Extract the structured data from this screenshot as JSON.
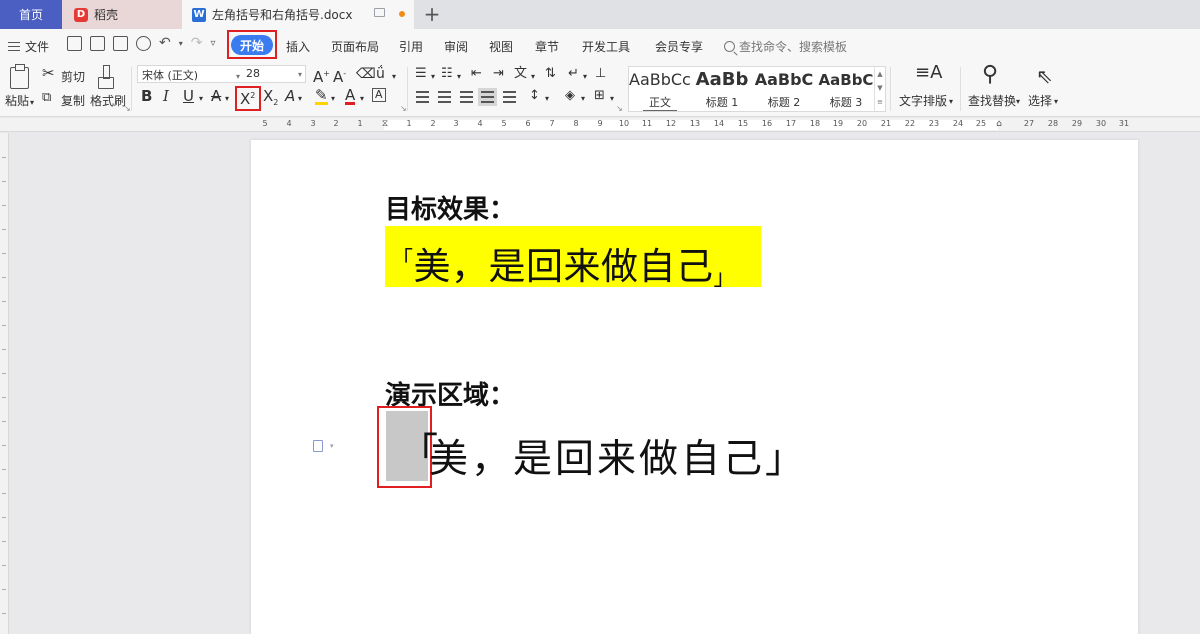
{
  "tabs": {
    "home": "首页",
    "daoke": "稻壳",
    "document": "左角括号和右角括号.docx"
  },
  "menu": {
    "file": "文件",
    "items": [
      "开始",
      "插入",
      "页面布局",
      "引用",
      "审阅",
      "视图",
      "章节",
      "开发工具",
      "会员专享"
    ],
    "search_placeholder": "查找命令、搜索模板"
  },
  "ribbon": {
    "cut": "剪切",
    "paste": "粘贴",
    "copy": "复制",
    "format_painter": "格式刷",
    "font_name": "宋体 (正文)",
    "font_size": "28",
    "styles": [
      {
        "preview": "AaBbCcDd",
        "label": "正文"
      },
      {
        "preview": "AaBb",
        "label": "标题 1"
      },
      {
        "preview": "AaBbC",
        "label": "标题 2"
      },
      {
        "preview": "AaBbC",
        "label": "标题 3"
      }
    ],
    "text_layout": "文字排版",
    "find_replace": "查找替换",
    "select": "选择"
  },
  "ruler": {
    "left_labels": [
      "5",
      "4",
      "3",
      "2",
      "1"
    ],
    "right_labels": [
      "1",
      "2",
      "3",
      "4",
      "5",
      "6",
      "7",
      "8",
      "9",
      "10",
      "11",
      "12",
      "13",
      "14",
      "15",
      "16",
      "17",
      "18",
      "19",
      "20",
      "21",
      "22",
      "23",
      "24",
      "25",
      "27",
      "28",
      "29",
      "30",
      "31"
    ]
  },
  "document": {
    "heading_target": "目标效果：",
    "target_text": "美，是回来做自己",
    "corner_open": "「",
    "corner_close": "」",
    "heading_demo": "演示区域：",
    "demo_text": "美，是回来做自己",
    "demo_open": "「",
    "demo_close": "」"
  },
  "colors": {
    "accent": "#3a7bf0",
    "highlight": "#ffff00",
    "annotation": "#e02020",
    "home_tab": "#4a5fc1"
  }
}
